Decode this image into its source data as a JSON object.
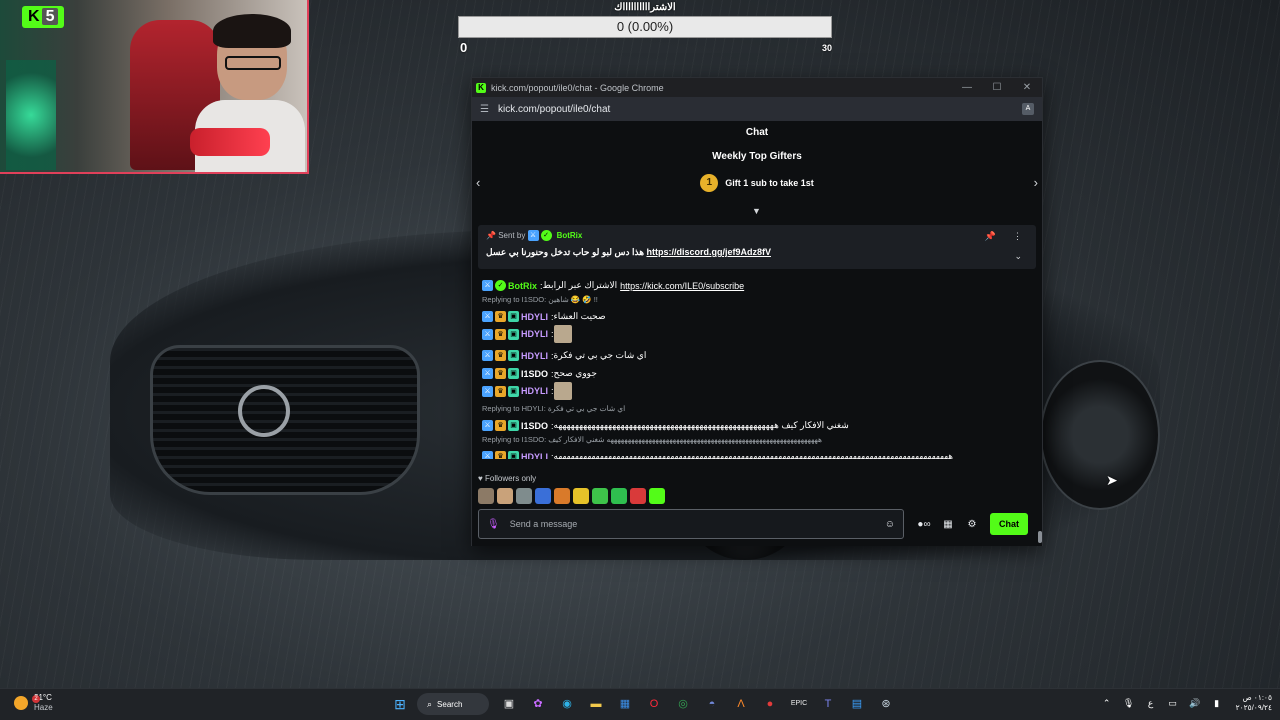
{
  "poll": {
    "title": "الاشترااااااااااك",
    "bar_text": "0 (0.00%)",
    "min": "0",
    "max": "30"
  },
  "webcam": {
    "badge_main": "K",
    "badge_num": "5"
  },
  "window": {
    "title": "kick.com/popout/ile0/chat - Google Chrome",
    "url": "kick.com/popout/ile0/chat"
  },
  "chat": {
    "header": "Chat",
    "gifters_title": "Weekly Top Gifters",
    "gifter_rank": "1",
    "gifter_text": "Gift 1 sub to take 1st",
    "pinned": {
      "sent_by": "Sent by",
      "bot_name": "BotRix",
      "message": "هذا دس لبو لو حاب تدخل وحنورنا بي عسل",
      "link": "https://discord.gg/jef9Adz8fV"
    },
    "messages": [
      {
        "type": "msg",
        "user": "BotRix",
        "user_color": "#53fc18",
        "badges": [
          "mod",
          "verified"
        ],
        "text": "الاشتراك عبر الرابط",
        "link": "https://kick.com/ILE0/subscribe"
      },
      {
        "type": "reply",
        "text": "Replying to I1SDO: شاهين 😂 🤣 !!"
      },
      {
        "type": "msg",
        "user": "HDYLI",
        "user_color": "#c79bff",
        "badges": [
          "mod",
          "vip",
          "sub"
        ],
        "text": "صحيت العشاء"
      },
      {
        "type": "msg",
        "user": "HDYLI",
        "user_color": "#c79bff",
        "badges": [
          "mod",
          "vip",
          "sub"
        ],
        "text": "",
        "emote": true
      },
      {
        "type": "msg",
        "user": "HDYLI",
        "user_color": "#c79bff",
        "badges": [
          "mod",
          "vip",
          "sub"
        ],
        "text": "اي شات جي بي تي فكرة"
      },
      {
        "type": "msg",
        "user": "I1SDO",
        "user_color": "#ffffff",
        "badges": [
          "mod",
          "vip",
          "sub"
        ],
        "text": "جووي صحح"
      },
      {
        "type": "msg",
        "user": "HDYLI",
        "user_color": "#c79bff",
        "badges": [
          "mod",
          "vip",
          "sub"
        ],
        "text": "",
        "emote": true
      },
      {
        "type": "reply",
        "text": "Replying to HDYLI: اي شات جي بي تي فكرة"
      },
      {
        "type": "msg",
        "user": "I1SDO",
        "user_color": "#ffffff",
        "badges": [
          "mod",
          "vip",
          "sub"
        ],
        "text": "شغني الافكار كيف هههههههههههههههههههههههههههههههههههههههههههههههههههههه"
      },
      {
        "type": "reply",
        "text": "Replying to I1SDO: هههههههههههههههههههههههههههههههههههههههههههههههههههههههههههههه شغني الافكار كيف"
      },
      {
        "type": "msg",
        "user": "HDYLI",
        "user_color": "#c79bff",
        "badges": [
          "mod",
          "vip",
          "sub"
        ],
        "text": "هههههههههههههههههههههههههههههههههههههههههههههههههههههههههههههههههههههههههههههههههههههههههههههههه"
      }
    ],
    "followers_only": "Followers only",
    "send_placeholder": "Send a message",
    "chat_button": "Chat"
  },
  "taskbar": {
    "temp": "31°C",
    "condition": "Haze",
    "search_label": "Search",
    "notif_count": "2",
    "time": "٠١:٠٥ ص",
    "date": "٢٠٢٥/٠٩/٢٤",
    "lang": "ع"
  }
}
